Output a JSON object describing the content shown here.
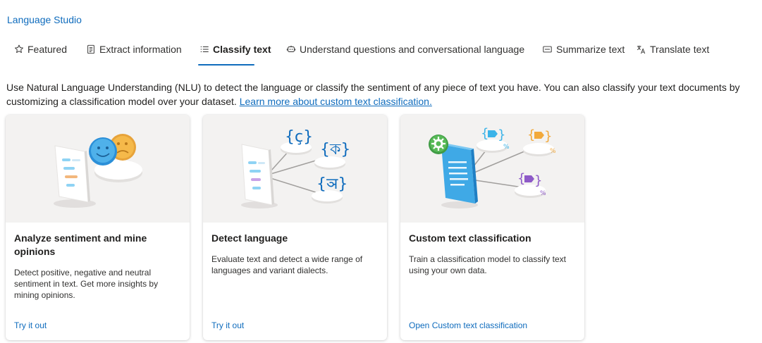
{
  "app": {
    "title": "Language Studio"
  },
  "tabs": [
    {
      "label": "Featured",
      "icon": "star-icon",
      "selected": false
    },
    {
      "label": "Extract information",
      "icon": "document-icon",
      "selected": false
    },
    {
      "label": "Classify text",
      "icon": "list-icon",
      "selected": true
    },
    {
      "label": "Understand questions and conversational language",
      "icon": "chat-bot-icon",
      "selected": false
    },
    {
      "label": "Summarize text",
      "icon": "summary-icon",
      "selected": false
    },
    {
      "label": "Translate text",
      "icon": "translate-icon",
      "selected": false
    }
  ],
  "intro": {
    "text": "Use Natural Language Understanding (NLU) to detect the language or classify the sentiment of any piece of text you have. You can also classify your text documents by customizing a classification model over your dataset. ",
    "link": "Learn more about custom text classification."
  },
  "cards": [
    {
      "title": "Analyze sentiment and mine opinions",
      "description": "Detect positive, negative and neutral sentiment in text. Get more insights by mining opinions.",
      "link": "Try it out",
      "illustration": "sentiment-illustration"
    },
    {
      "title": "Detect language",
      "description": "Evaluate text and detect a wide range of languages and variant dialects.",
      "link": "Try it out",
      "illustration": "language-detection-illustration",
      "glyphs": [
        "{ç}",
        "{ক}",
        "{ञ}"
      ]
    },
    {
      "title": "Custom text classification",
      "description": "Train a classification model to classify text using your own data.",
      "link": "Open Custom text classification",
      "illustration": "custom-classification-illustration"
    }
  ],
  "colors": {
    "accent": "#0f6cbd",
    "card_image_bg": "#f3f2f1",
    "tag_blue": "#3bb3e8",
    "tag_orange": "#f2a93b",
    "tag_purple": "#8e5ac8",
    "gear_green": "#4caf50"
  }
}
